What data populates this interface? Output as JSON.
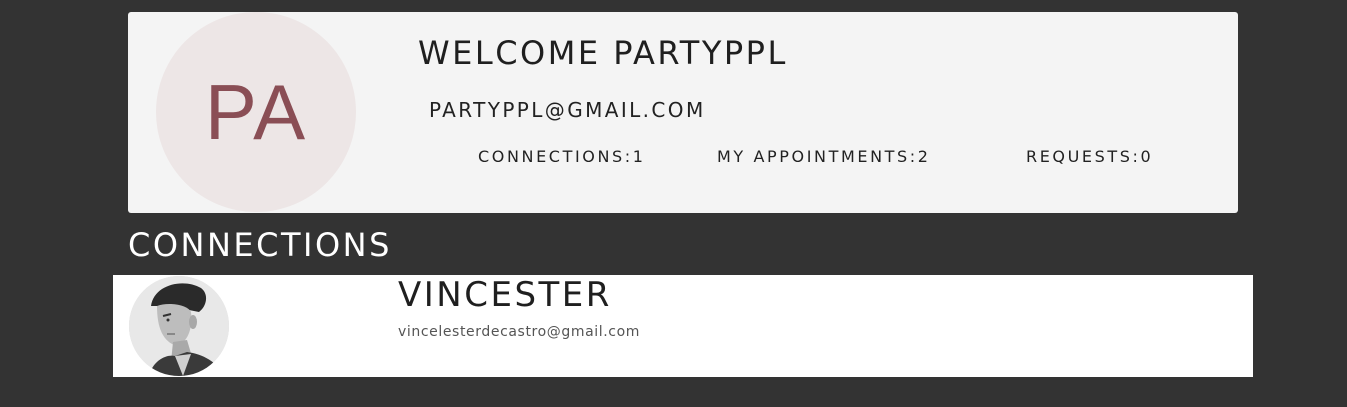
{
  "profile": {
    "avatar_initials": "PA",
    "welcome": "WELCOME PARTYPPL",
    "email": "PARTYPPL@GMAIL.COM",
    "stats": {
      "connections": "CONNECTIONS:1",
      "appointments": "MY APPOINTMENTS:2",
      "requests": "REQUESTS:0"
    }
  },
  "connections_section": {
    "heading": "CONNECTIONS",
    "items": [
      {
        "name": "VINCESTER",
        "email": "vincelesterdecastro@gmail.com",
        "avatar_icon": "profile-photo"
      }
    ]
  },
  "colors": {
    "page_bg": "#333333",
    "card_bg": "#f4f4f4",
    "avatar_bg": "#ede6e6",
    "avatar_text": "#8a4e55"
  }
}
